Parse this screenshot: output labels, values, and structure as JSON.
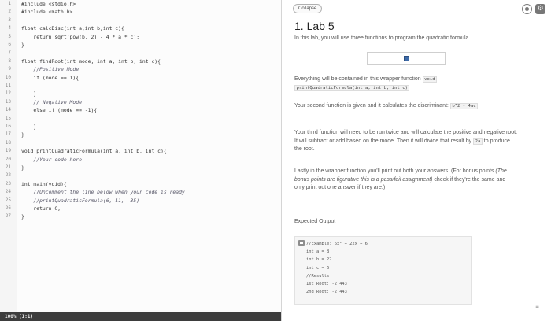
{
  "editor": {
    "lines": [
      {
        "n": "1",
        "text": "#include <stdio.h>",
        "comment": false
      },
      {
        "n": "2",
        "text": "#include <math.h>",
        "comment": false
      },
      {
        "n": "3",
        "text": "",
        "comment": false
      },
      {
        "n": "4",
        "text": "float calcDisc(int a,int b,int c){",
        "comment": false
      },
      {
        "n": "5",
        "text": "    return sqrt(pow(b, 2) - 4 * a * c);",
        "comment": false
      },
      {
        "n": "6",
        "text": "}",
        "comment": false
      },
      {
        "n": "7",
        "text": "",
        "comment": false
      },
      {
        "n": "8",
        "text": "float findRoot(int mode, int a, int b, int c){",
        "comment": false
      },
      {
        "n": "9",
        "text": "    //Positive Mode",
        "comment": true
      },
      {
        "n": "10",
        "text": "    if (mode == 1){",
        "comment": false
      },
      {
        "n": "11",
        "text": "",
        "comment": false
      },
      {
        "n": "12",
        "text": "    }",
        "comment": false
      },
      {
        "n": "13",
        "text": "    // Negative Mode",
        "comment": true
      },
      {
        "n": "14",
        "text": "    else if (mode == -1){",
        "comment": false
      },
      {
        "n": "15",
        "text": "",
        "comment": false
      },
      {
        "n": "16",
        "text": "    }",
        "comment": false
      },
      {
        "n": "17",
        "text": "}",
        "comment": false
      },
      {
        "n": "18",
        "text": "",
        "comment": false
      },
      {
        "n": "19",
        "text": "void printQuadraticFormula(int a, int b, int c){",
        "comment": false
      },
      {
        "n": "20",
        "text": "    //Your code here",
        "comment": true
      },
      {
        "n": "21",
        "text": "}",
        "comment": false
      },
      {
        "n": "22",
        "text": "",
        "comment": false
      },
      {
        "n": "23",
        "text": "int main(void){",
        "comment": false
      },
      {
        "n": "24",
        "text": "    //Uncomment the line below when your code is ready",
        "comment": true
      },
      {
        "n": "25",
        "text": "    //printQuadraticFormula(6, 11, -35)",
        "comment": true
      },
      {
        "n": "26",
        "text": "    return 0;",
        "comment": false
      },
      {
        "n": "27",
        "text": "}",
        "comment": false
      }
    ],
    "status": "100% (1:1)"
  },
  "panel": {
    "collapse_label": "Collapse",
    "settings_glyph": "⚙",
    "title": "1. Lab 5",
    "intro": "In this lab, you will use three functions to program the quadratic formula",
    "p1_a": "Everything will be contained in this wrapper function ",
    "p1_code1": "void",
    "p1_code2": "printQuadraticFormula(int a, int b, int c)",
    "p2_a": "Your second function is given and it calculates the discriminant: ",
    "p2_code": "b^2 - 4ac",
    "p3_a": "Your third function will need to be run twice and will calculate the positive and negative root. It will subtract or add based on the mode. Then it will divide that result by ",
    "p3_code": "2a",
    "p3_b": " to produce the root.",
    "p4_a": "Lastly in the wrapper function you'll print out both your answers. (For bonus points ",
    "p4_em": "(The bonus points are figurative this is a pass/fail assignment)",
    "p4_b": " check if they're the same and only print out one answer if they are.)",
    "expected_label": "Expected Output",
    "output_lines": [
      "//Example: 6x² + 22x + 6",
      "int a = 8",
      "int b = 22",
      "int c = 6",
      "//Results",
      "1st Root: -2.443",
      "2nd Root: -2.443"
    ],
    "wrap_glyph": "≡"
  }
}
